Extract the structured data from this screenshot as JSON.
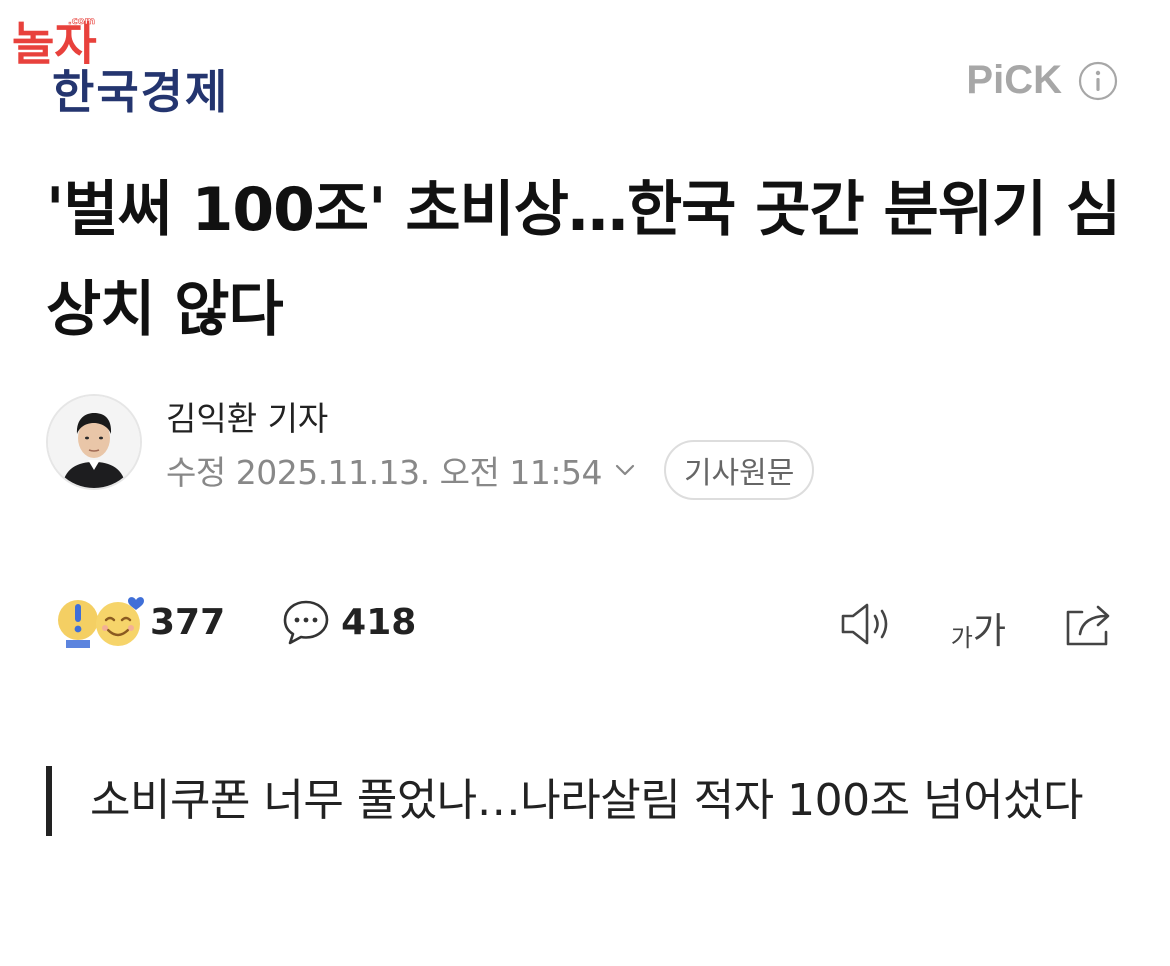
{
  "watermark": {
    "text": "놀자",
    "subtext": ".com",
    "color": "#e8413c"
  },
  "press": {
    "name": "한국경제",
    "color": "#24356f"
  },
  "pick": {
    "label": "PiCK",
    "icon": "info-icon"
  },
  "article": {
    "headline": "'벌써 100조' 초비상…한국 곳간 분위기 심상치 않다",
    "reporter": "김익환 기자",
    "date": "수정 2025.11.13. 오전 11:54",
    "original_button": "기사원문",
    "subheadline": "소비쿠폰 너무 풀었나…나라살림 적자 100조 넘어섰다"
  },
  "reactions": {
    "count": "377",
    "icons": [
      "exclamation-face-icon",
      "heart-smile-face-icon"
    ]
  },
  "comments": {
    "count": "418",
    "icon": "comment-bubble-icon"
  },
  "tools": {
    "tts_icon": "speaker-icon",
    "font_size": {
      "small": "가",
      "big": "가"
    },
    "share_icon": "share-icon"
  }
}
